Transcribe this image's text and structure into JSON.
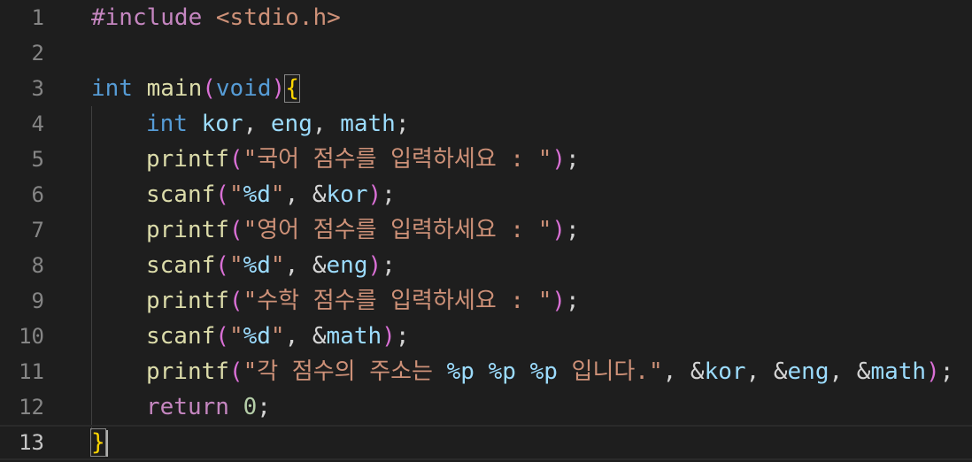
{
  "theme": {
    "background": "#1e1e1e",
    "line_number": "#858585",
    "line_number_active": "#c6c6c6",
    "keyword": "#569cd6",
    "preprocessor": "#c586c0",
    "control": "#c586c0",
    "function": "#dcdcaa",
    "string": "#ce9178",
    "format_specifier": "#9cdcfe",
    "variable": "#9cdcfe",
    "number": "#b5cea8",
    "bracket_level1": "#ffd700",
    "bracket_level2": "#da70d6",
    "plain": "#d4d4d4"
  },
  "editor": {
    "current_line": 13,
    "lines": [
      {
        "n": "1",
        "indent": false,
        "tokens": [
          {
            "t": "#include ",
            "c": "preprocessor"
          },
          {
            "t": "<stdio.h>",
            "c": "string"
          }
        ]
      },
      {
        "n": "2",
        "indent": false,
        "tokens": []
      },
      {
        "n": "3",
        "indent": false,
        "tokens": [
          {
            "t": "int",
            "c": "keyword"
          },
          {
            "t": " ",
            "c": "plain"
          },
          {
            "t": "main",
            "c": "function"
          },
          {
            "t": "(",
            "c": "bracket_level2"
          },
          {
            "t": "void",
            "c": "keyword"
          },
          {
            "t": ")",
            "c": "bracket_level2"
          },
          {
            "t": "{",
            "c": "bracket_level1",
            "match": true
          }
        ]
      },
      {
        "n": "4",
        "indent": true,
        "tokens": [
          {
            "t": "int",
            "c": "keyword"
          },
          {
            "t": " ",
            "c": "plain"
          },
          {
            "t": "kor",
            "c": "variable"
          },
          {
            "t": ", ",
            "c": "plain"
          },
          {
            "t": "eng",
            "c": "variable"
          },
          {
            "t": ", ",
            "c": "plain"
          },
          {
            "t": "math",
            "c": "variable"
          },
          {
            "t": ";",
            "c": "plain"
          }
        ]
      },
      {
        "n": "5",
        "indent": true,
        "tokens": [
          {
            "t": "printf",
            "c": "function"
          },
          {
            "t": "(",
            "c": "bracket_level2"
          },
          {
            "t": "\"국어 점수를 입력하세요 : \"",
            "c": "string"
          },
          {
            "t": ")",
            "c": "bracket_level2"
          },
          {
            "t": ";",
            "c": "plain"
          }
        ]
      },
      {
        "n": "6",
        "indent": true,
        "tokens": [
          {
            "t": "scanf",
            "c": "function"
          },
          {
            "t": "(",
            "c": "bracket_level2"
          },
          {
            "t": "\"",
            "c": "string"
          },
          {
            "t": "%d",
            "c": "format_specifier"
          },
          {
            "t": "\"",
            "c": "string"
          },
          {
            "t": ", &",
            "c": "plain"
          },
          {
            "t": "kor",
            "c": "variable"
          },
          {
            "t": ")",
            "c": "bracket_level2"
          },
          {
            "t": ";",
            "c": "plain"
          }
        ]
      },
      {
        "n": "7",
        "indent": true,
        "tokens": [
          {
            "t": "printf",
            "c": "function"
          },
          {
            "t": "(",
            "c": "bracket_level2"
          },
          {
            "t": "\"영어 점수를 입력하세요 : \"",
            "c": "string"
          },
          {
            "t": ")",
            "c": "bracket_level2"
          },
          {
            "t": ";",
            "c": "plain"
          }
        ]
      },
      {
        "n": "8",
        "indent": true,
        "tokens": [
          {
            "t": "scanf",
            "c": "function"
          },
          {
            "t": "(",
            "c": "bracket_level2"
          },
          {
            "t": "\"",
            "c": "string"
          },
          {
            "t": "%d",
            "c": "format_specifier"
          },
          {
            "t": "\"",
            "c": "string"
          },
          {
            "t": ", &",
            "c": "plain"
          },
          {
            "t": "eng",
            "c": "variable"
          },
          {
            "t": ")",
            "c": "bracket_level2"
          },
          {
            "t": ";",
            "c": "plain"
          }
        ]
      },
      {
        "n": "9",
        "indent": true,
        "tokens": [
          {
            "t": "printf",
            "c": "function"
          },
          {
            "t": "(",
            "c": "bracket_level2"
          },
          {
            "t": "\"수학 점수를 입력하세요 : \"",
            "c": "string"
          },
          {
            "t": ")",
            "c": "bracket_level2"
          },
          {
            "t": ";",
            "c": "plain"
          }
        ]
      },
      {
        "n": "10",
        "indent": true,
        "tokens": [
          {
            "t": "scanf",
            "c": "function"
          },
          {
            "t": "(",
            "c": "bracket_level2"
          },
          {
            "t": "\"",
            "c": "string"
          },
          {
            "t": "%d",
            "c": "format_specifier"
          },
          {
            "t": "\"",
            "c": "string"
          },
          {
            "t": ", &",
            "c": "plain"
          },
          {
            "t": "math",
            "c": "variable"
          },
          {
            "t": ")",
            "c": "bracket_level2"
          },
          {
            "t": ";",
            "c": "plain"
          }
        ]
      },
      {
        "n": "11",
        "indent": true,
        "tokens": [
          {
            "t": "printf",
            "c": "function"
          },
          {
            "t": "(",
            "c": "bracket_level2"
          },
          {
            "t": "\"각 점수의 주소는 ",
            "c": "string"
          },
          {
            "t": "%p",
            "c": "format_specifier"
          },
          {
            "t": " ",
            "c": "string"
          },
          {
            "t": "%p",
            "c": "format_specifier"
          },
          {
            "t": " ",
            "c": "string"
          },
          {
            "t": "%p",
            "c": "format_specifier"
          },
          {
            "t": " 입니다.\"",
            "c": "string"
          },
          {
            "t": ", &",
            "c": "plain"
          },
          {
            "t": "kor",
            "c": "variable"
          },
          {
            "t": ", &",
            "c": "plain"
          },
          {
            "t": "eng",
            "c": "variable"
          },
          {
            "t": ", &",
            "c": "plain"
          },
          {
            "t": "math",
            "c": "variable"
          },
          {
            "t": ")",
            "c": "bracket_level2"
          },
          {
            "t": ";",
            "c": "plain"
          }
        ]
      },
      {
        "n": "12",
        "indent": true,
        "tokens": [
          {
            "t": "return",
            "c": "control"
          },
          {
            "t": " ",
            "c": "plain"
          },
          {
            "t": "0",
            "c": "number"
          },
          {
            "t": ";",
            "c": "plain"
          }
        ]
      },
      {
        "n": "13",
        "indent": false,
        "tokens": [
          {
            "t": "}",
            "c": "bracket_level1",
            "match": true
          }
        ],
        "cursor": true
      }
    ]
  }
}
